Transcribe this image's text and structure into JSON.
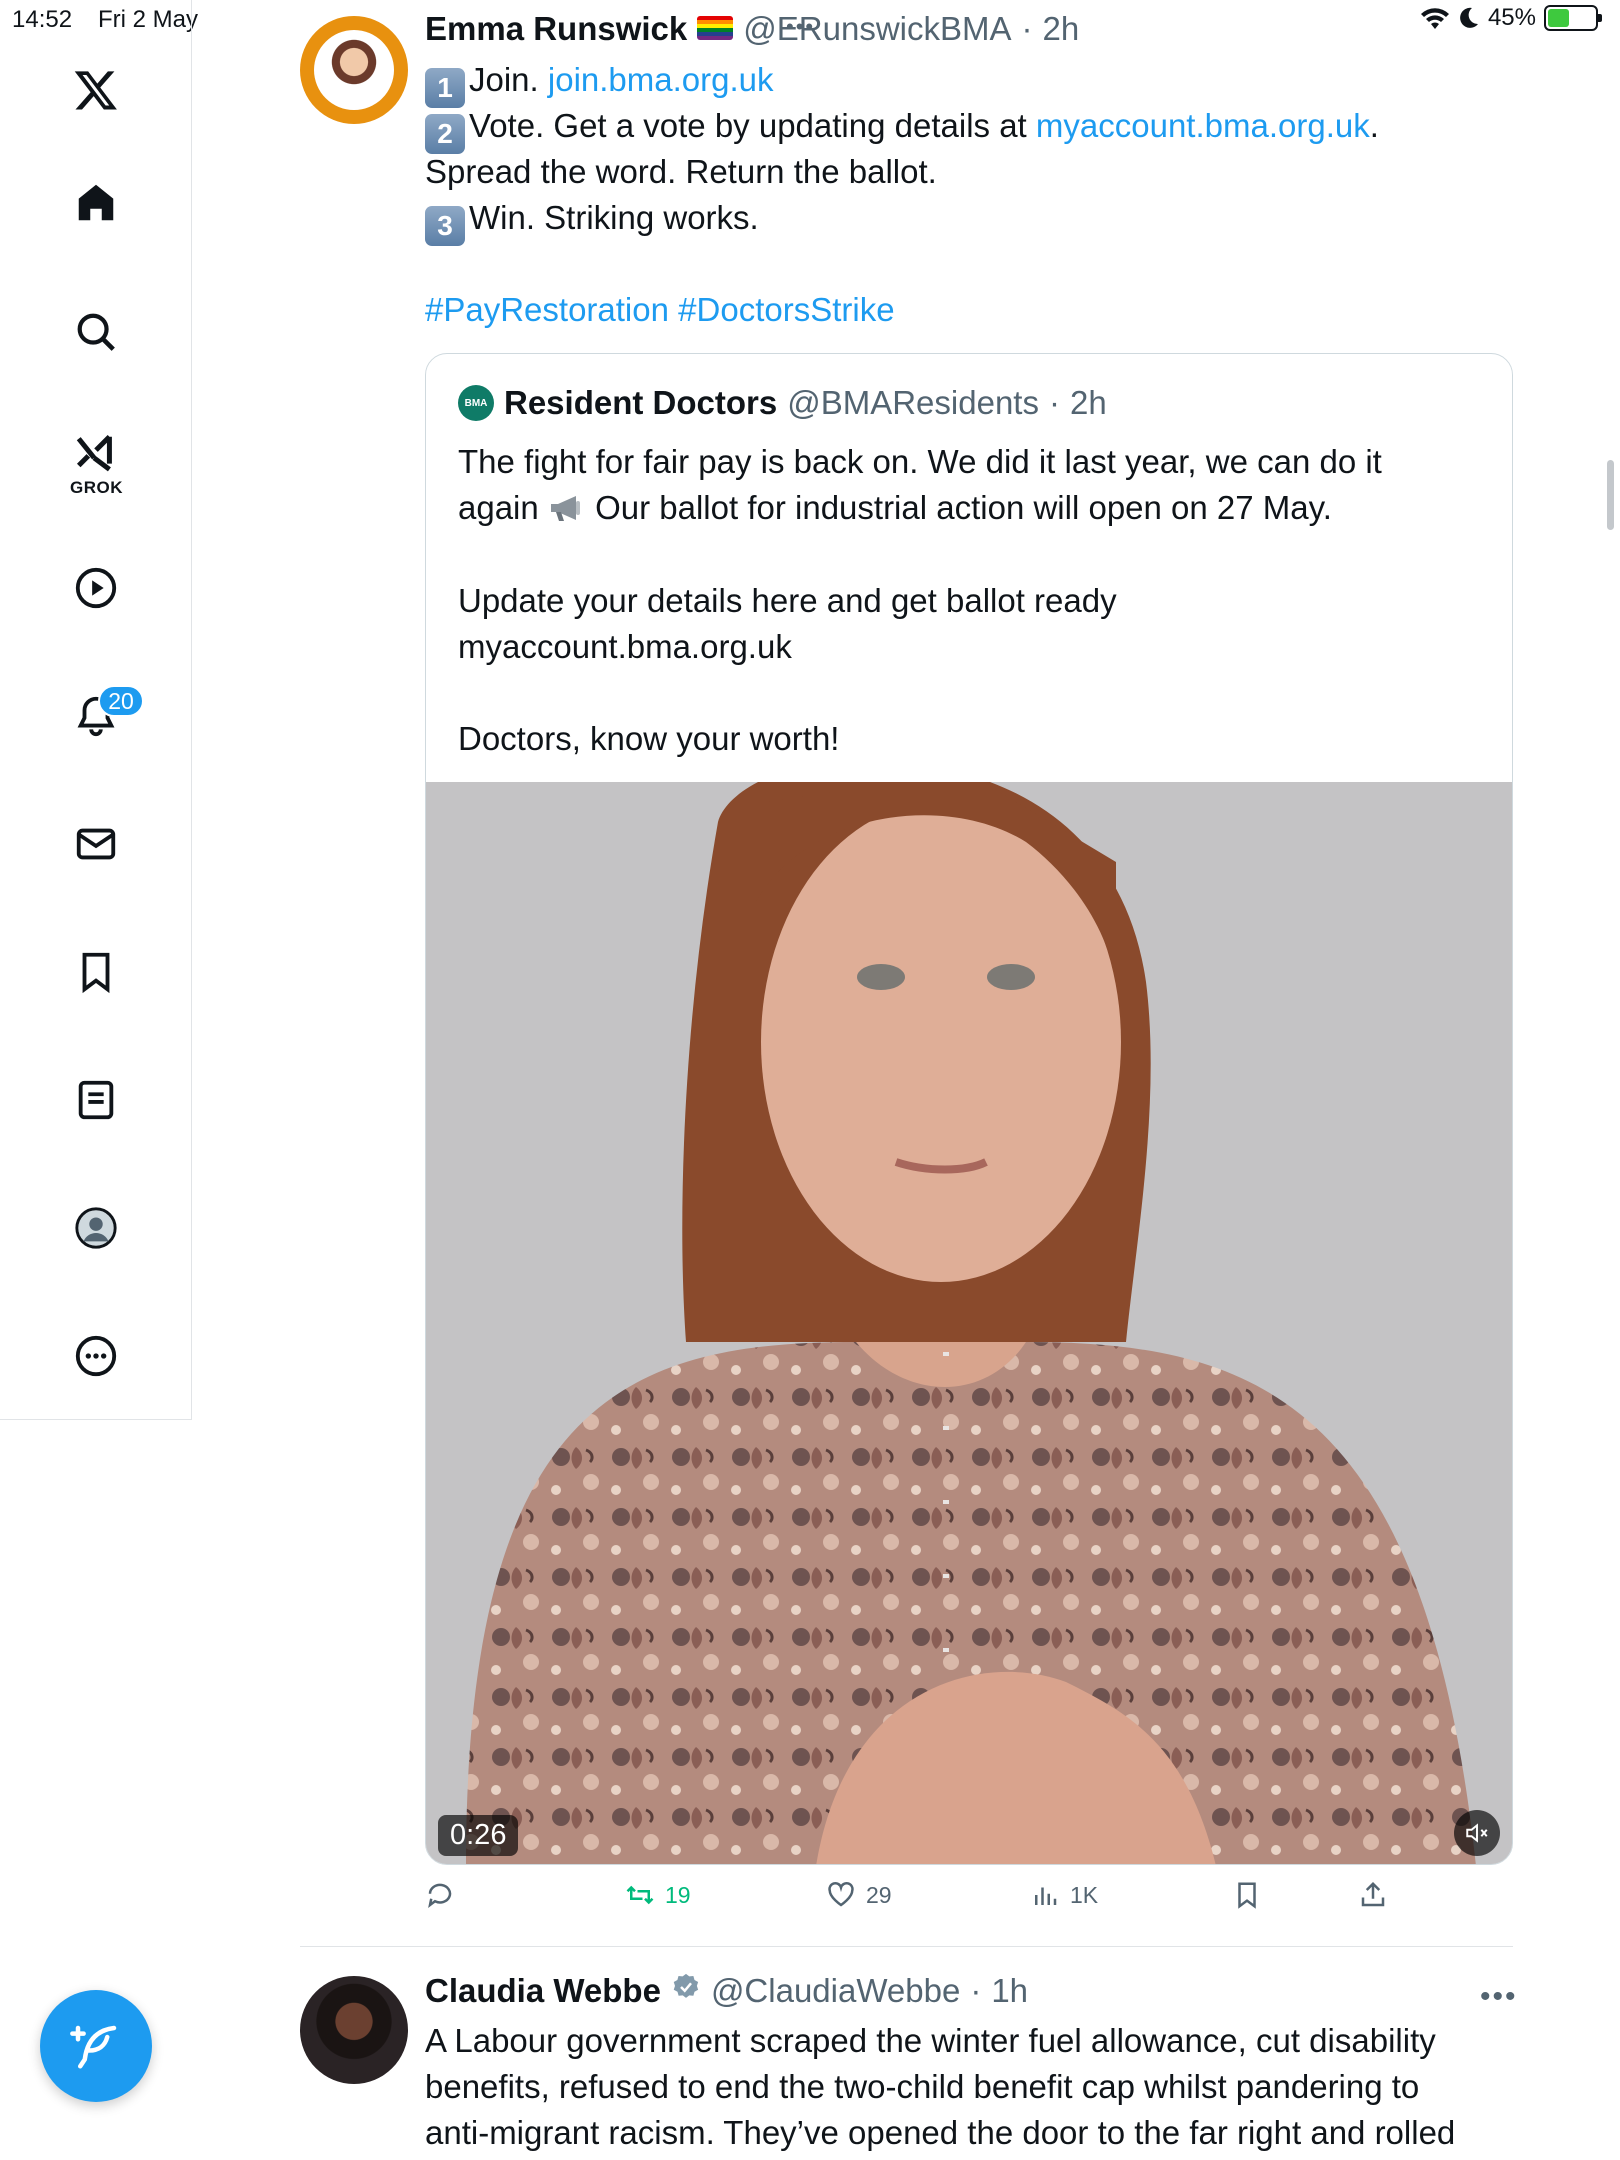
{
  "status_bar": {
    "time": "14:52",
    "date": "Fri 2 May",
    "battery": "45%",
    "battery_level": 0.45,
    "multitasking_dots": "•••"
  },
  "sidebar": {
    "items": [
      {
        "name": "x-logo-icon"
      },
      {
        "name": "home-icon"
      },
      {
        "name": "search-icon"
      },
      {
        "name": "grok-icon",
        "label": "GROK"
      },
      {
        "name": "video-icon"
      },
      {
        "name": "notifications-icon",
        "badge": "20"
      },
      {
        "name": "messages-icon"
      },
      {
        "name": "bookmarks-icon"
      },
      {
        "name": "lists-icon"
      },
      {
        "name": "profile-icon"
      },
      {
        "name": "more-icon"
      }
    ],
    "compose_button": "compose-icon"
  },
  "tweet1": {
    "display_name": "Emma Runswick",
    "flag": "rainbow-flag",
    "handle": "@ERunswickBMA",
    "separator": "·",
    "time": "2h",
    "line1_key": "1",
    "line1_text": "Join.",
    "line1_link": "join.bma.org.uk",
    "line2_key": "2",
    "line2_text": "Vote. Get a vote by updating details at",
    "line2_link": "myaccount.bma.org.uk",
    "line2_end": ".",
    "line3": "Spread the word. Return the ballot.",
    "line4_key": "3",
    "line4_text": "Win. Striking works.",
    "hashtag1": "#PayRestoration",
    "hashtag2": "#DoctorsStrike",
    "quote": {
      "logo_text": "BMA",
      "display_name": "Resident Doctors",
      "handle": "@BMAResidents",
      "separator": "·",
      "time": "2h",
      "line1": "The fight for fair pay is back on. We did it last year, we can do it",
      "line2_start": "again",
      "line2_end": "Our ballot for industrial action will open on 27 May.",
      "line3": "Update your details here and get ballot ready",
      "line4": "myaccount.bma.org.uk",
      "line5": "Doctors, know your worth!",
      "video_duration": "0:26"
    },
    "actions": {
      "reply_count": "",
      "retweet_count": "19",
      "like_count": "29",
      "views_count": "1K"
    }
  },
  "tweet2": {
    "display_name": "Claudia Webbe",
    "handle": "@ClaudiaWebbe",
    "separator": "·",
    "time": "1h",
    "more": "•••",
    "line1": "A Labour government scraped the winter fuel allowance, cut disability",
    "line2": "benefits, refused to end the two-child benefit cap whilst pandering to",
    "line3": "anti-migrant racism. They’ve opened the door to the far right and rolled"
  },
  "colors": {
    "accent": "#1d9bf0",
    "text": "#0f1419",
    "muted": "#536471",
    "retweet": "#00ba7c",
    "avatar_ring": "#e8910f"
  }
}
